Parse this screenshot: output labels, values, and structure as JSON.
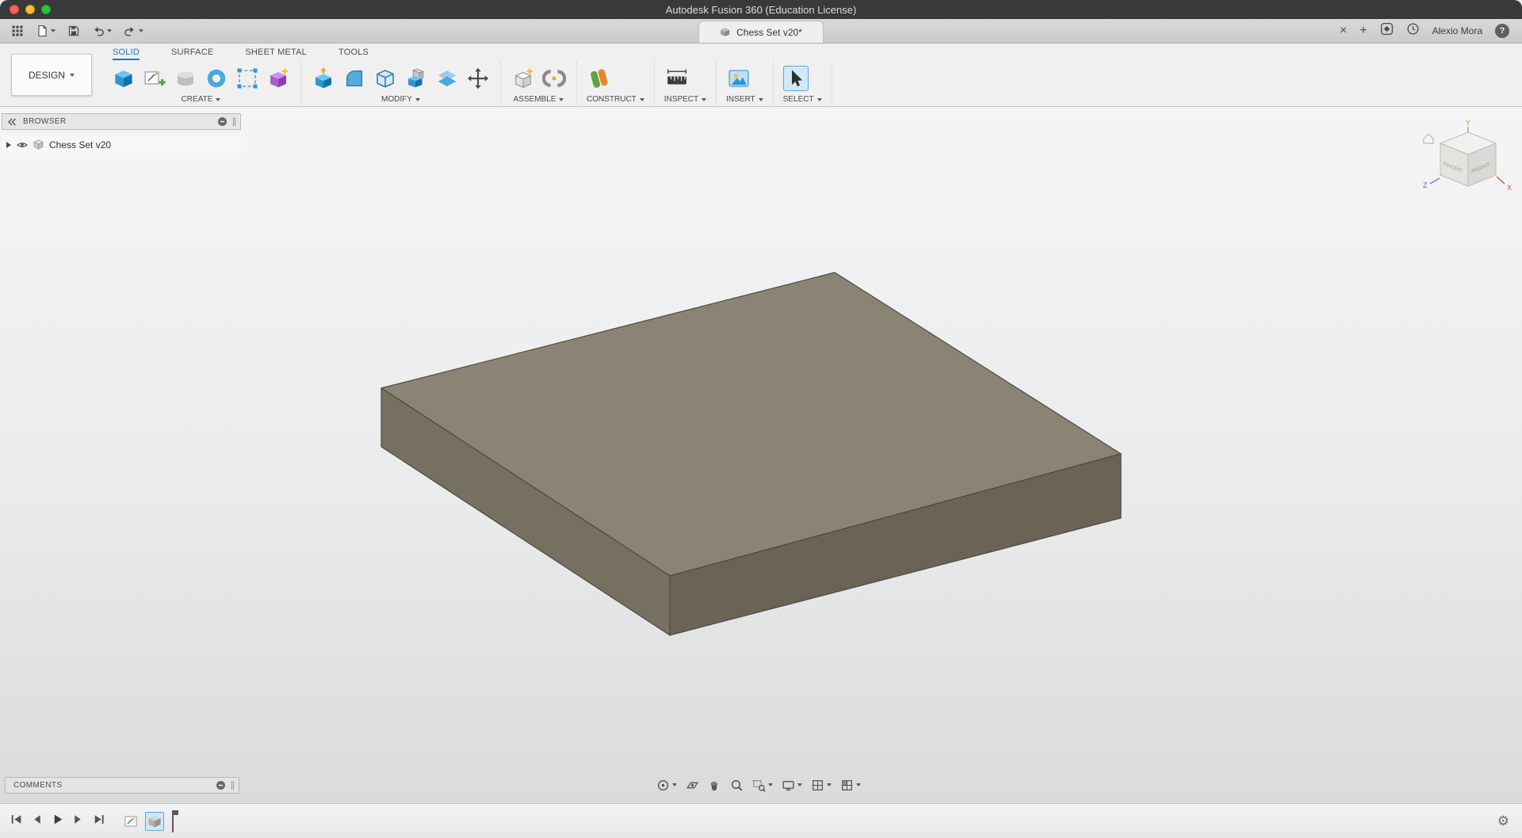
{
  "colors": {
    "accent_blue": "#0f7dc2",
    "box_top_face": "#8b8374",
    "box_left_face": "#767061",
    "box_right_face": "#6b6456",
    "axis_x_red": "#d4483a",
    "axis_y_green": "#6ab53c",
    "axis_z_blue": "#4a63d4"
  },
  "titlebar": {
    "title": "Autodesk Fusion 360 (Education License)"
  },
  "tabbar": {
    "document_tab_label": "Chess Set v20*",
    "close_tab_glyph": "×",
    "new_tab_glyph": "+",
    "user_name": "Alexio Mora",
    "help_glyph": "?"
  },
  "ribbon": {
    "workspace_label": "DESIGN",
    "tabs": [
      {
        "label": "SOLID"
      },
      {
        "label": "SURFACE"
      },
      {
        "label": "SHEET METAL"
      },
      {
        "label": "TOOLS"
      }
    ],
    "groups": {
      "create": "CREATE",
      "modify": "MODIFY",
      "assemble": "ASSEMBLE",
      "construct": "CONSTRUCT",
      "inspect": "INSPECT",
      "insert": "INSERT",
      "select": "SELECT"
    }
  },
  "browser": {
    "title": "BROWSER",
    "root_item_label": "Chess Set v20"
  },
  "comments": {
    "title": "COMMENTS"
  },
  "viewcube": {
    "front_label": "FRONT",
    "right_label": "RIGHT",
    "axis_x": "X",
    "axis_y": "Y",
    "axis_z": "Z"
  },
  "statusbar": {
    "settings_glyph": "⚙"
  }
}
